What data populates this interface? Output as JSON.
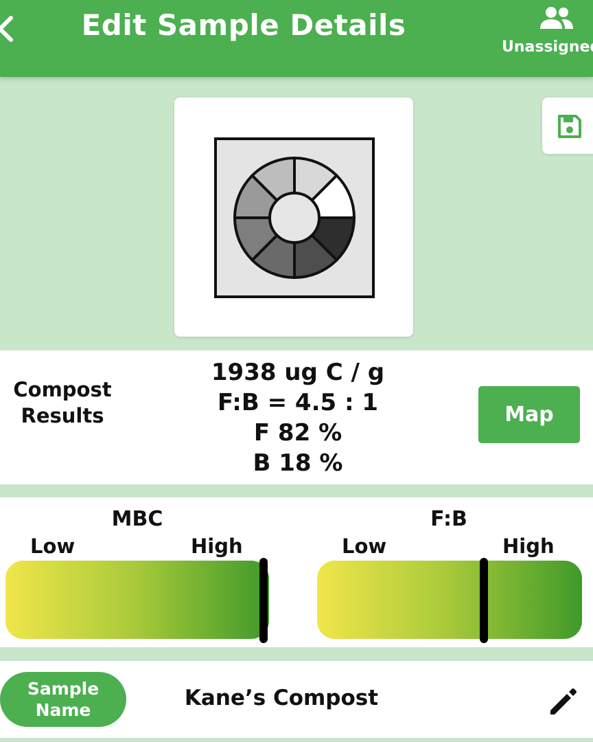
{
  "header": {
    "title": "Edit Sample Details",
    "assignee_label": "Unassigned"
  },
  "icons": {
    "back": "chevron-left-icon",
    "assign": "group-icon",
    "save": "floppy-disk-icon",
    "edit": "pencil-icon"
  },
  "results": {
    "label_line1": "Compost",
    "label_line2": "Results",
    "mbc": "1938 ug C / g",
    "fb_ratio": "F:B = 4.5 : 1",
    "fungi": "F 82 %",
    "bacteria": "B 18 %",
    "map_label": "Map"
  },
  "gauges": {
    "mbc": {
      "title": "MBC",
      "low_label": "Low",
      "high_label": "High",
      "level": 0.98
    },
    "fb": {
      "title": "F:B",
      "low_label": "Low",
      "high_label": "High",
      "level": 0.63
    }
  },
  "sample": {
    "name_label_line1": "Sample",
    "name_label_line2": "Name",
    "name_value": "Kane’s Compost"
  },
  "colors": {
    "primary_green": "#4caf50",
    "background_green": "#c8e6c9",
    "gauge_low": "#f0e64a",
    "gauge_high": "#3f9a2a"
  }
}
